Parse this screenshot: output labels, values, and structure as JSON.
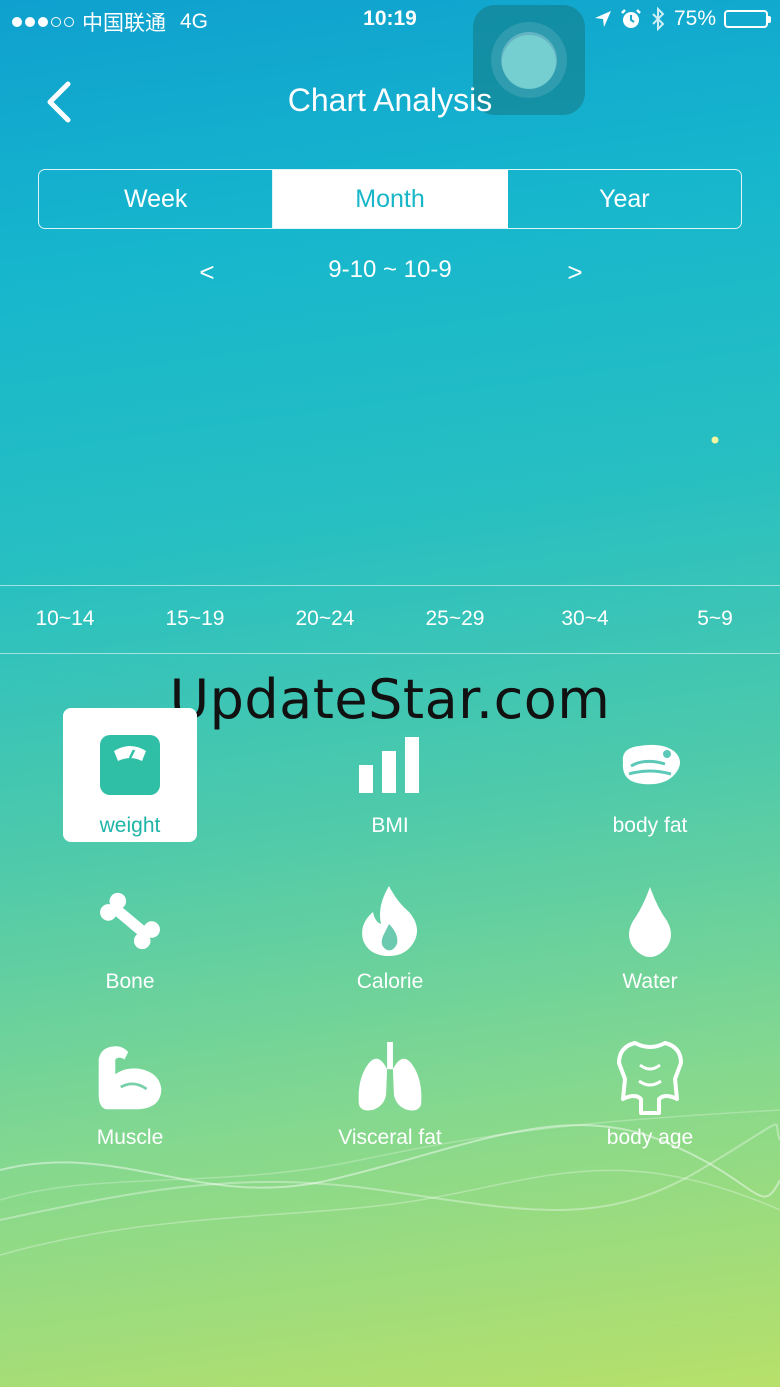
{
  "status_bar": {
    "carrier": "中国联通",
    "network": "4G",
    "time": "10:19",
    "battery": "75%",
    "battery_level": 0.75,
    "signal_bars": 3,
    "signal_total": 5
  },
  "header": {
    "back_icon": "chevron-left-icon",
    "title": "Chart Analysis"
  },
  "period_tabs": [
    {
      "label": "Week",
      "active": false
    },
    {
      "label": "Month",
      "active": true
    },
    {
      "label": "Year",
      "active": false
    }
  ],
  "range": {
    "prev": "<",
    "label": "9-10 ~ 10-9",
    "next": ">"
  },
  "chart_data": {
    "type": "scatter",
    "categories": [
      "10~14",
      "15~19",
      "20~24",
      "25~29",
      "30~4",
      "5~9"
    ],
    "points": [
      {
        "category": "5~9",
        "marker_color": "#f1f5a0"
      }
    ]
  },
  "watermark": "UpdateStar.com",
  "metrics": [
    {
      "label": "weight",
      "icon": "scale-icon",
      "active": true
    },
    {
      "label": "BMI",
      "icon": "bar-chart-icon",
      "active": false
    },
    {
      "label": "body fat",
      "icon": "meat-icon",
      "active": false
    },
    {
      "label": "Bone",
      "icon": "bone-icon",
      "active": false
    },
    {
      "label": "Calorie",
      "icon": "flame-icon",
      "active": false
    },
    {
      "label": "Water",
      "icon": "water-drop-icon",
      "active": false
    },
    {
      "label": "Muscle",
      "icon": "muscle-arm-icon",
      "active": false
    },
    {
      "label": "Visceral fat",
      "icon": "lungs-icon",
      "active": false
    },
    {
      "label": "body age",
      "icon": "body-icon",
      "active": false
    }
  ],
  "colors": {
    "accent": "#17b6c8",
    "active_icon": "#2fbfa6"
  }
}
